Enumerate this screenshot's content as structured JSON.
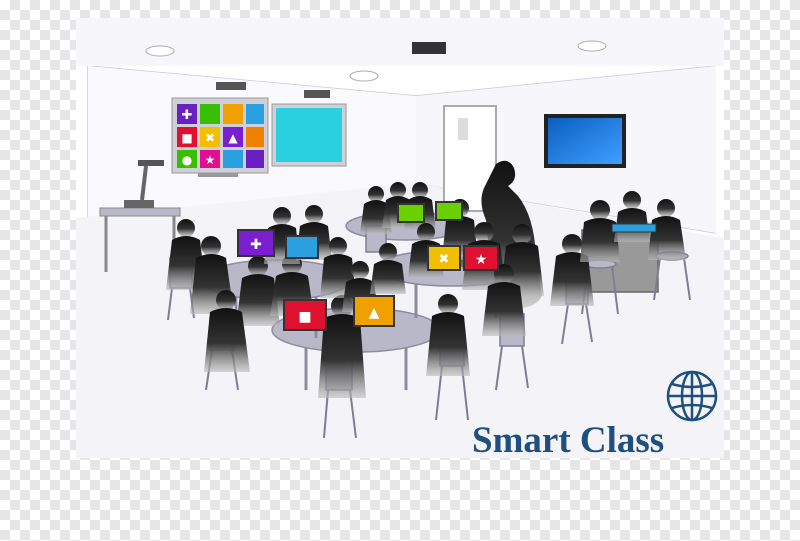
{
  "logo": {
    "text": "Smart Class",
    "icon": "globe-icon",
    "color": "#1f4f7f"
  },
  "colors": {
    "silhouette": "#1a1a1a",
    "wall": "#ffffff",
    "floor": "#f4f4f8",
    "furniture": "#b9b8c8",
    "screen_blue": "#1a6fd0",
    "screen_cyan": "#2bd0e0",
    "laptop_purple": "#7a1fd0",
    "laptop_green": "#6ad000",
    "laptop_orange": "#f0a000",
    "laptop_red": "#e01030"
  }
}
